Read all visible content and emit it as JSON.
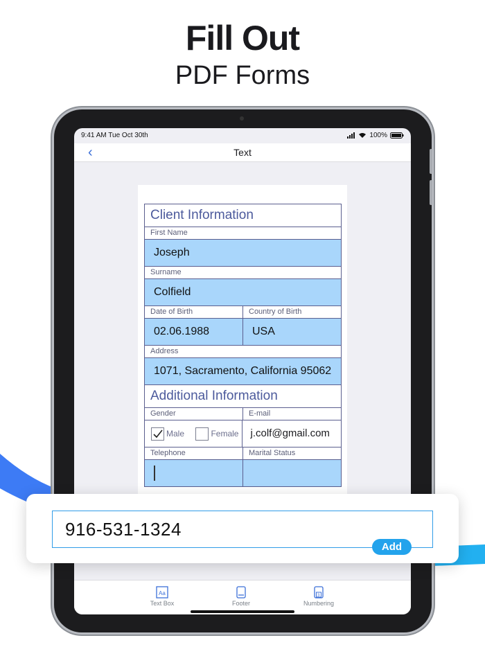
{
  "headline": {
    "title": "Fill Out",
    "subtitle": "PDF Forms"
  },
  "status": {
    "time": "9:41 AM  Tue Oct 30th",
    "battery": "100%"
  },
  "nav": {
    "back": "‹",
    "title": "Text"
  },
  "form": {
    "client_section": "Client Information",
    "first_name_label": "First Name",
    "first_name_value": "Joseph",
    "surname_label": "Surname",
    "surname_value": "Colfield",
    "dob_label": "Date of Birth",
    "dob_value": "02.06.1988",
    "cob_label": "Country of Birth",
    "cob_value": "USA",
    "address_label": "Address",
    "address_value": "1071, Sacramento, California 95062",
    "additional_section": "Additional Information",
    "gender_label": "Gender",
    "email_label": "E-mail",
    "male_label": "Male",
    "male_checked": true,
    "female_label": "Female",
    "female_checked": false,
    "email_value": "j.colf@gmail.com",
    "telephone_label": "Telephone",
    "marital_label": "Marital Status"
  },
  "text_input": {
    "value": "916-531-1324",
    "add_label": "Add"
  },
  "tabs": [
    {
      "label": "Text Box",
      "icon": "text-box-icon"
    },
    {
      "label": "Footer",
      "icon": "footer-icon"
    },
    {
      "label": "Numbering",
      "icon": "numbering-icon"
    }
  ],
  "colors": {
    "accent": "#23a3ec",
    "field_fill": "#a9d6fb",
    "form_border": "#5a5e8e",
    "swoosh": "#3d7bf5"
  }
}
